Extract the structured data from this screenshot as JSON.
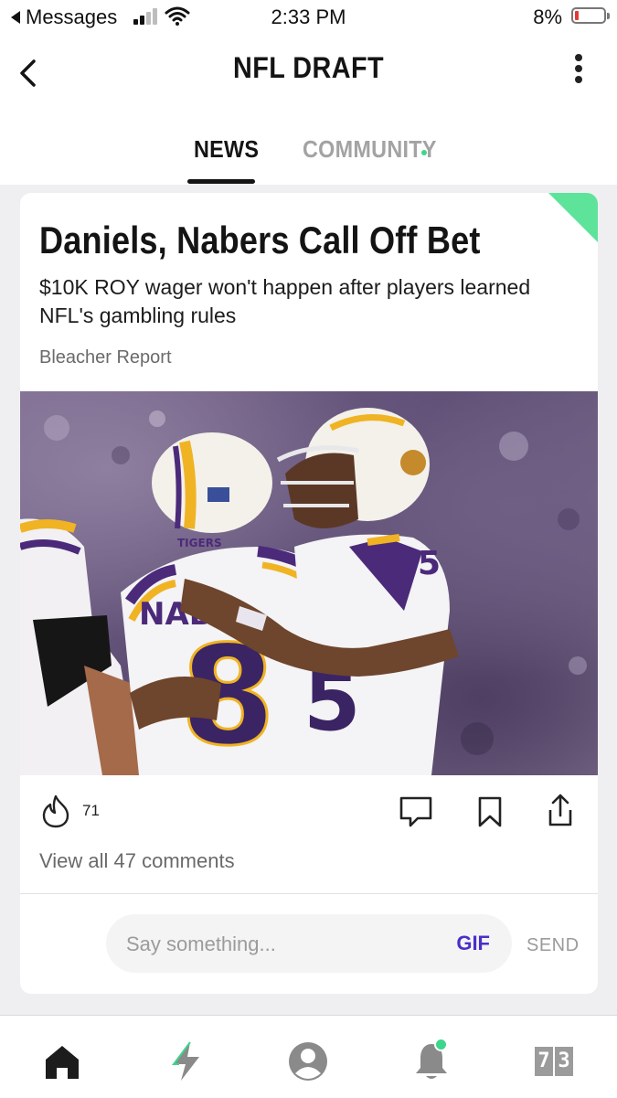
{
  "status_bar": {
    "back_app": "Messages",
    "time": "2:33 PM",
    "battery": "8%"
  },
  "header": {
    "title": "NFL DRAFT",
    "tabs": [
      {
        "label": "NEWS",
        "active": true
      },
      {
        "label": "COMMUNITY",
        "active": false,
        "has_new_indicator": true
      }
    ]
  },
  "article": {
    "headline": "Daniels, Nabers Call Off Bet",
    "subhead": "$10K ROY wager won't happen after players learned NFL's gambling rules",
    "source": "Bleacher Report",
    "reactions": {
      "fire_count": "71"
    },
    "comments_link": "View all 47 comments"
  },
  "comment_box": {
    "placeholder": "Say something...",
    "gif_label": "GIF",
    "send_label": "SEND"
  },
  "bottom_nav": {
    "items": [
      "home-icon",
      "bolt-icon",
      "profile-icon",
      "bell-icon",
      "scores-icon"
    ],
    "scores_digits": [
      "7",
      "3"
    ]
  },
  "colors": {
    "accent_green": "#5ee39b",
    "gif_purple": "#4a2fc9",
    "battery_red": "#e53935"
  }
}
